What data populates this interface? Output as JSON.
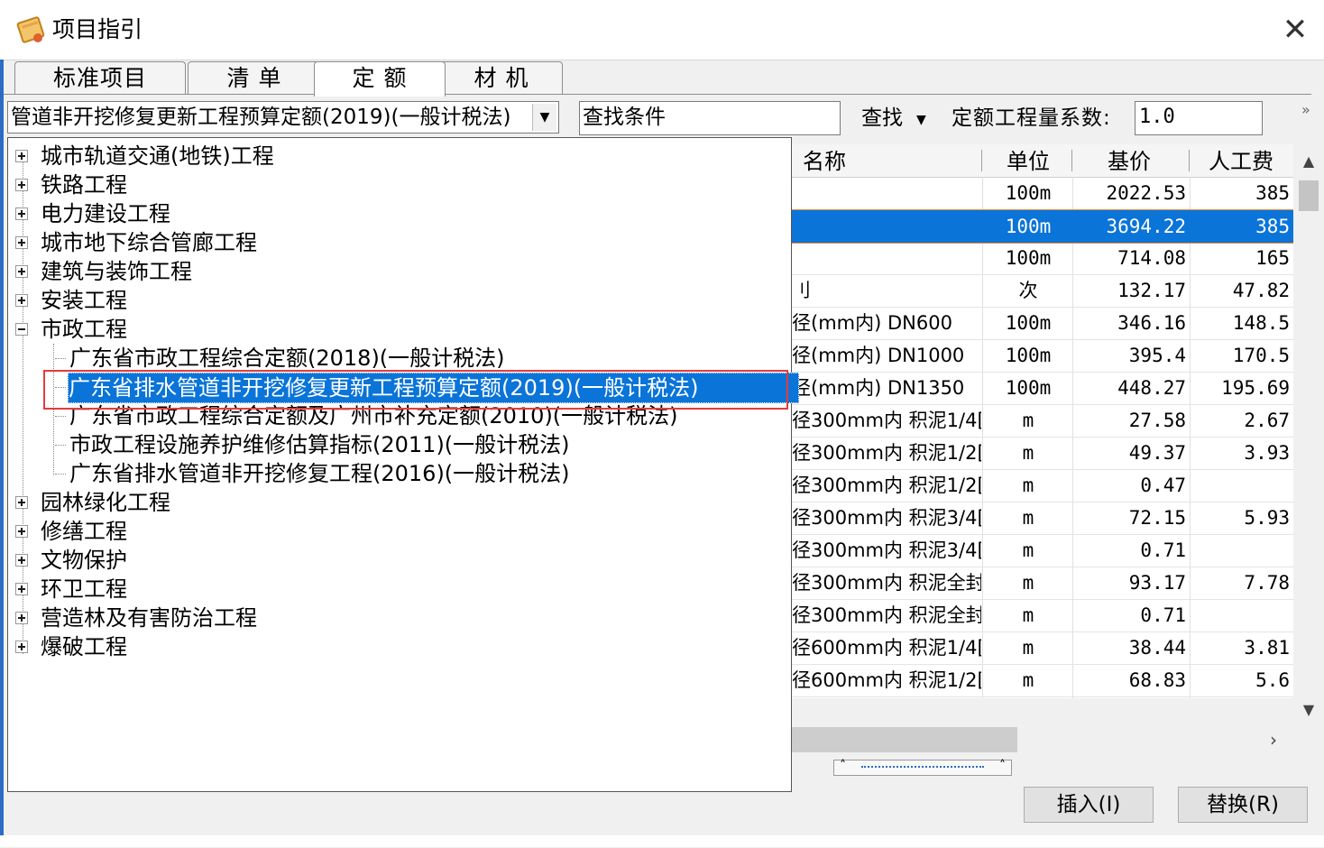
{
  "window": {
    "title": "项目指引",
    "close_glyph": "✕"
  },
  "tabs": [
    {
      "label": "标准项目"
    },
    {
      "label": "清 单"
    },
    {
      "label": "定 额"
    },
    {
      "label": "材 机"
    }
  ],
  "toolbar": {
    "library_selected": "管道非开挖修复更新工程预算定额(2019)(一般计税法)",
    "search_placeholder": "查找条件",
    "find_label": "查找",
    "coef_label": "定额工程量系数:",
    "coef_value": "1.0",
    "more_glyph": "»"
  },
  "tree": [
    {
      "label": "城市轨道交通(地铁)工程"
    },
    {
      "label": "铁路工程"
    },
    {
      "label": "电力建设工程"
    },
    {
      "label": "城市地下综合管廊工程"
    },
    {
      "label": "建筑与装饰工程"
    },
    {
      "label": "安装工程"
    },
    {
      "label": "市政工程",
      "children": [
        {
          "label": "广东省市政工程综合定额(2018)(一般计税法)"
        },
        {
          "label": "广东省排水管道非开挖修复更新工程预算定额(2019)(一般计税法)",
          "selected": true
        },
        {
          "label": "广东省市政工程综合定额及广州市补充定额(2010)(一般计税法)"
        },
        {
          "label": "市政工程设施养护维修估算指标(2011)(一般计税法)"
        },
        {
          "label": "广东省排水管道非开挖修复工程(2016)(一般计税法)"
        }
      ]
    },
    {
      "label": "园林绿化工程"
    },
    {
      "label": "修缮工程"
    },
    {
      "label": "文物保护"
    },
    {
      "label": "环卫工程"
    },
    {
      "label": "营造林及有害防治工程"
    },
    {
      "label": "爆破工程"
    }
  ],
  "table": {
    "headers": {
      "name": "名称",
      "unit": "单位",
      "price": "基价",
      "labor": "人工费"
    },
    "rows": [
      {
        "name": "",
        "unit": "100m",
        "price": "2022.53",
        "labor": "385"
      },
      {
        "name": "",
        "unit": "100m",
        "price": "3694.22",
        "labor": "385",
        "selected": true
      },
      {
        "name": "",
        "unit": "100m",
        "price": "714.08",
        "labor": "165"
      },
      {
        "name": "刂",
        "unit": "次",
        "price": "132.17",
        "labor": "47.82"
      },
      {
        "name": "径(mm内) DN600",
        "unit": "100m",
        "price": "346.16",
        "labor": "148.5"
      },
      {
        "name": "径(mm内) DN1000",
        "unit": "100m",
        "price": "395.4",
        "labor": "170.5"
      },
      {
        "name": "径(mm内) DN1350",
        "unit": "100m",
        "price": "448.27",
        "labor": "195.69"
      },
      {
        "name": "径300mm内 积泥1/4[",
        "unit": "m",
        "price": "27.58",
        "labor": "2.67"
      },
      {
        "name": "径300mm内 积泥1/2[",
        "unit": "m",
        "price": "49.37",
        "labor": "3.93"
      },
      {
        "name": "径300mm内 积泥1/2[",
        "unit": "m",
        "price": "0.47",
        "labor": ""
      },
      {
        "name": "径300mm内 积泥3/4[",
        "unit": "m",
        "price": "72.15",
        "labor": "5.93"
      },
      {
        "name": "径300mm内 积泥3/4[",
        "unit": "m",
        "price": "0.71",
        "labor": ""
      },
      {
        "name": "径300mm内 积泥全封",
        "unit": "m",
        "price": "93.17",
        "labor": "7.78"
      },
      {
        "name": "径300mm内 积泥全封",
        "unit": "m",
        "price": "0.71",
        "labor": ""
      },
      {
        "name": "径600mm内 积泥1/4[",
        "unit": "m",
        "price": "38.44",
        "labor": "3.81"
      },
      {
        "name": "径600mm内 积泥1/2[",
        "unit": "m",
        "price": "68.83",
        "labor": "5.6"
      }
    ]
  },
  "buttons": {
    "insert": "插入(I)",
    "replace": "替换(R)"
  },
  "colors": {
    "selection": "#0a74d8",
    "highlight_box": "#e33c3c"
  }
}
